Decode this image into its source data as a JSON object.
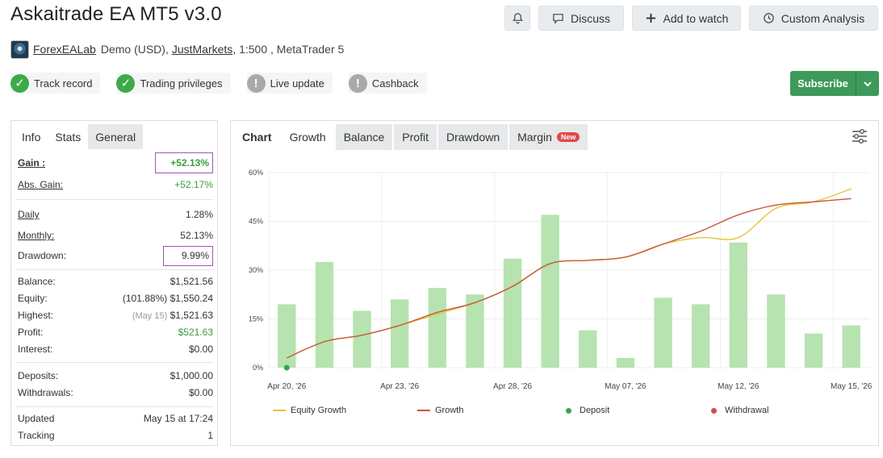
{
  "header": {
    "title": "Askaitrade EA MT5 v3.0",
    "discuss": "Discuss",
    "watch": "Add to watch",
    "analysis": "Custom Analysis"
  },
  "account": {
    "author": "ForexEALab",
    "type": "Demo (USD),",
    "broker": "JustMarkets",
    "rest": ", 1:500 , MetaTrader 5"
  },
  "badges": [
    "Track record",
    "Trading privileges",
    "Live update",
    "Cashback"
  ],
  "subscribe": "Subscribe",
  "left_tabs": [
    "Info",
    "Stats",
    "General"
  ],
  "stats": {
    "gain_label": "Gain :",
    "gain": "+52.13%",
    "abs_gain_label": "Abs. Gain:",
    "abs_gain": "+52.17%",
    "daily_label": "Daily",
    "daily": "1.28%",
    "monthly_label": "Monthly:",
    "monthly": "52.13%",
    "drawdown_label": "Drawdown:",
    "drawdown": "9.99%",
    "balance_label": "Balance:",
    "balance": "$1,521.56",
    "equity_label": "Equity:",
    "equity_pct": "(101.88%)",
    "equity": "$1,550.24",
    "highest_label": "Highest:",
    "highest_date": "(May 15)",
    "highest": "$1,521.63",
    "profit_label": "Profit:",
    "profit": "$521.63",
    "interest_label": "Interest:",
    "interest": "$0.00",
    "deposits_label": "Deposits:",
    "deposits": "$1,000.00",
    "withdrawals_label": "Withdrawals:",
    "withdrawals": "$0.00",
    "updated_label": "Updated",
    "updated": "May 15 at 17:24",
    "tracking_label": "Tracking",
    "tracking": "1"
  },
  "chart_tabs": {
    "label": "Chart",
    "tabs": [
      "Growth",
      "Balance",
      "Profit",
      "Drawdown",
      "Margin"
    ],
    "new_tag": "New"
  },
  "legend": {
    "equity": "Equity Growth",
    "growth": "Growth",
    "deposit": "Deposit",
    "withdrawal": "Withdrawal"
  },
  "colors": {
    "equity": "#e8c23a",
    "growth": "#c8583b",
    "deposit": "#35a848",
    "withdrawal": "#d84a4a",
    "bar": "#b6e3b0",
    "accent": "#3d9a5a"
  },
  "chart_data": {
    "type": "bar+line",
    "ylim": [
      0,
      60
    ],
    "y_ticks": [
      "0%",
      "15%",
      "30%",
      "45%",
      "60%"
    ],
    "x_ticks": [
      "Apr 20, '26",
      "Apr 23, '26",
      "Apr 28, '26",
      "May 07, '26",
      "May 12, '26",
      "May 15, '26"
    ],
    "bars": [
      19.5,
      32.5,
      17.5,
      21,
      24.5,
      22.5,
      33.5,
      47,
      11.5,
      3,
      21.5,
      19.5,
      38.5,
      22.5,
      10.5,
      13
    ],
    "series": [
      {
        "name": "Growth",
        "values": [
          3,
          8,
          10,
          13,
          17,
          20,
          25,
          32,
          33,
          34,
          38,
          42,
          47,
          50,
          51,
          52
        ]
      },
      {
        "name": "Equity Growth",
        "values": [
          3,
          8,
          10,
          13,
          16.5,
          20,
          25,
          32,
          33,
          34,
          38,
          40,
          40,
          49,
          51,
          55
        ]
      }
    ],
    "deposit_points": [
      0
    ]
  }
}
